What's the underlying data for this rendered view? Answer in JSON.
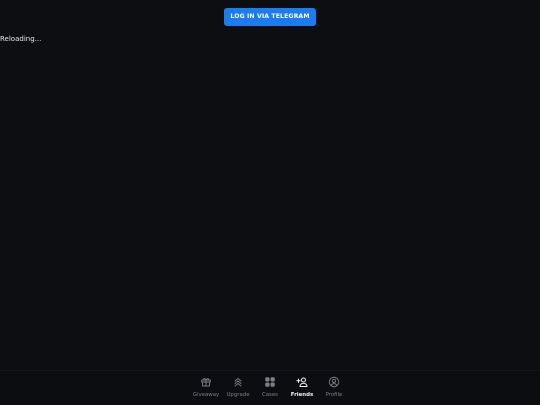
{
  "header": {
    "login_label": "LOG IN VIA TELEGRAM"
  },
  "main": {
    "status_text": "Reloading..."
  },
  "bottom_nav": {
    "active": "Friends",
    "items": [
      {
        "label": "Giveaway",
        "icon": "gift-icon"
      },
      {
        "label": "Upgrade",
        "icon": "chevrons-up-icon"
      },
      {
        "label": "Cases",
        "icon": "grid-icon"
      },
      {
        "label": "Friends",
        "icon": "user-plus-icon"
      },
      {
        "label": "Profile",
        "icon": "user-circle-icon"
      }
    ]
  },
  "colors": {
    "background": "#0d0e12",
    "accent": "#1a7cf0",
    "nav_inactive": "#7d808a",
    "nav_active": "#f2f3f5"
  }
}
